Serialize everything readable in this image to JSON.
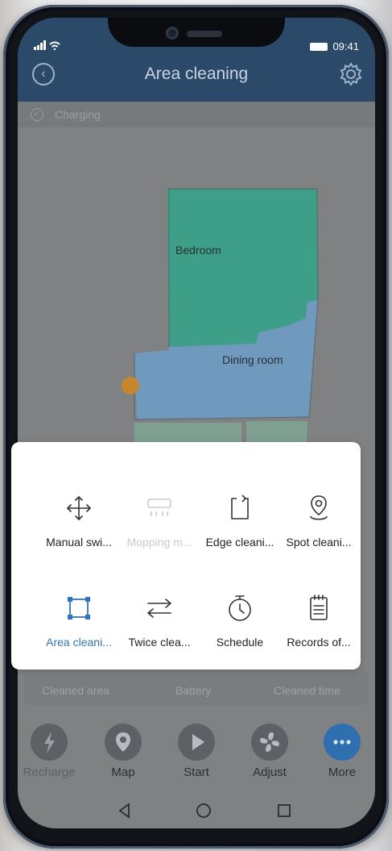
{
  "status_bar": {
    "time": "09:41"
  },
  "header": {
    "title": "Area cleaning"
  },
  "status": {
    "text": "Charging"
  },
  "map": {
    "rooms": [
      "Bedroom",
      "Dining room"
    ]
  },
  "stats": {
    "labels": [
      "Cleaned area",
      "Battery",
      "Cleaned time"
    ]
  },
  "popup": {
    "options": [
      {
        "label": "Manual swi...",
        "icon": "move-arrows-icon",
        "state": "normal"
      },
      {
        "label": "Mopping m...",
        "icon": "mop-icon",
        "state": "disabled"
      },
      {
        "label": "Edge cleani...",
        "icon": "edge-clean-icon",
        "state": "normal"
      },
      {
        "label": "Spot cleani...",
        "icon": "location-pin-icon",
        "state": "normal"
      },
      {
        "label": "Area cleani...",
        "icon": "area-square-icon",
        "state": "selected"
      },
      {
        "label": "Twice clea...",
        "icon": "swap-arrows-icon",
        "state": "normal"
      },
      {
        "label": "Schedule",
        "icon": "timer-icon",
        "state": "normal"
      },
      {
        "label": "Records of...",
        "icon": "clipboard-icon",
        "state": "normal"
      }
    ]
  },
  "actions": [
    {
      "label": "Recharge",
      "icon": "lightning-icon"
    },
    {
      "label": "Map",
      "icon": "map-pin-icon"
    },
    {
      "label": "Start",
      "icon": "play-icon"
    },
    {
      "label": "Adjust",
      "icon": "fan-icon"
    },
    {
      "label": "More",
      "icon": "more-dots-icon"
    }
  ],
  "colors": {
    "accent": "#2f74c0",
    "header": "#2b4a6a",
    "bedroom": "#3aa087",
    "dining": "#6f9ac0"
  }
}
